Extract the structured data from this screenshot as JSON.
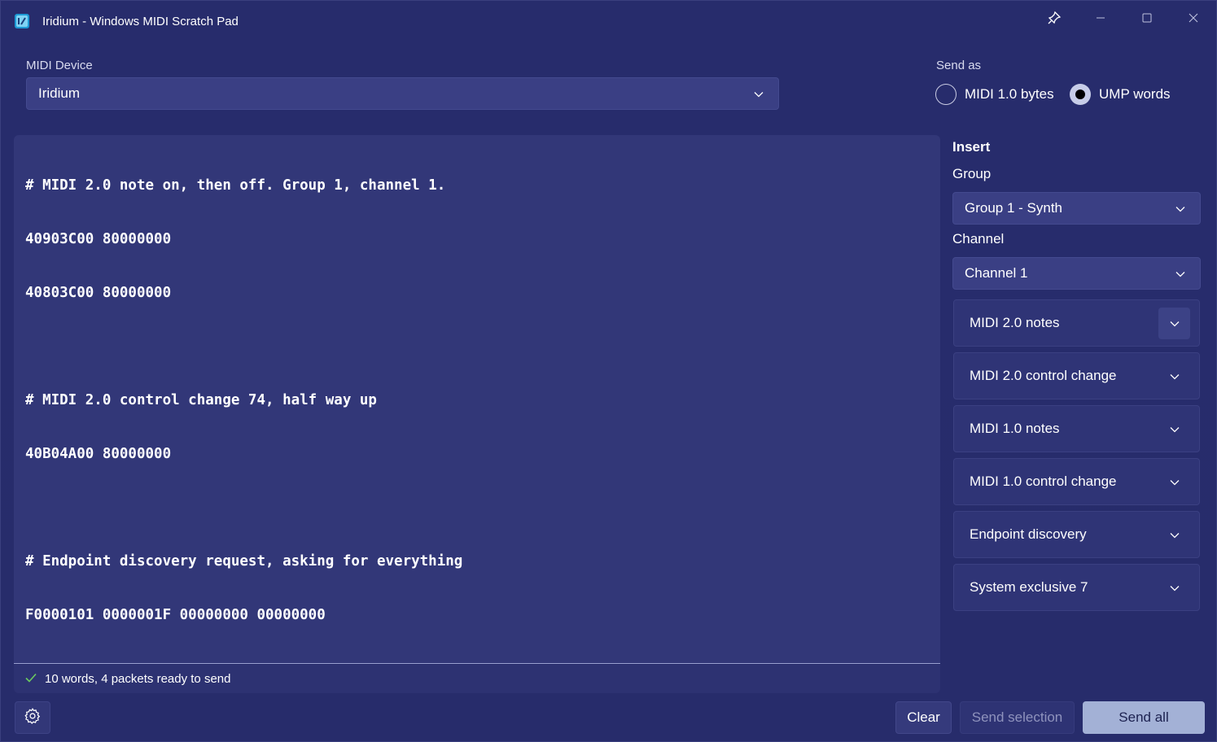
{
  "window": {
    "title": "Iridium - Windows MIDI Scratch Pad"
  },
  "device": {
    "label": "MIDI Device",
    "selected": "Iridium"
  },
  "send_as": {
    "label": "Send as",
    "options": [
      {
        "label": "MIDI 1.0 bytes",
        "checked": false
      },
      {
        "label": "UMP words",
        "checked": true
      }
    ]
  },
  "editor": {
    "lines": [
      "# MIDI 2.0 note on, then off. Group 1, channel 1.",
      "40903C00 80000000",
      "40803C00 80000000",
      "",
      "# MIDI 2.0 control change 74, half way up",
      "40B04A00 80000000",
      "",
      "# Endpoint discovery request, asking for everything",
      "F0000101 0000001F 00000000 00000000"
    ]
  },
  "status": {
    "text": "10 words, 4 packets ready to send"
  },
  "insert": {
    "title": "Insert",
    "group_label": "Group",
    "group_value": "Group 1 - Synth",
    "channel_label": "Channel",
    "channel_value": "Channel 1",
    "sections": [
      "MIDI 2.0 notes",
      "MIDI 2.0 control change",
      "MIDI 1.0 notes",
      "MIDI 1.0 control change",
      "Endpoint discovery",
      "System exclusive 7"
    ]
  },
  "buttons": {
    "clear": "Clear",
    "send_selection": "Send selection",
    "send_all": "Send all"
  },
  "colors": {
    "background": "#272c6c",
    "editor": "#323778",
    "accent_button": "#a3b1d6",
    "status_ok": "#6ccb5f"
  }
}
